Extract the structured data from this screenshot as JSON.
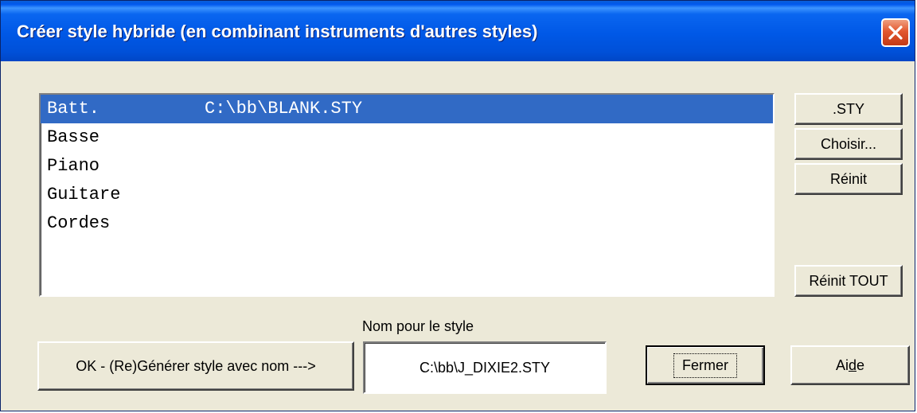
{
  "window": {
    "title": "Créer style hybride (en combinant instruments d'autres styles)"
  },
  "instrument_list": {
    "items": [
      {
        "name": "Batt.",
        "path": "C:\\bb\\BLANK.STY",
        "selected": true
      },
      {
        "name": "Basse",
        "path": "",
        "selected": false
      },
      {
        "name": "Piano",
        "path": "",
        "selected": false
      },
      {
        "name": "Guitare",
        "path": "",
        "selected": false
      },
      {
        "name": "Cordes",
        "path": "",
        "selected": false
      }
    ]
  },
  "side_buttons": {
    "sty_label": ".STY",
    "choose_label": "Choisir...",
    "reset_label": "Réinit",
    "reset_all_label": "Réinit TOUT"
  },
  "bottom": {
    "generate_label": "OK - (Re)Générer style avec nom --->",
    "style_name_label": "Nom pour le style",
    "style_name_value": "C:\\bb\\J_DIXIE2.STY",
    "close_label": "Fermer",
    "help_label_pre": "Ai",
    "help_label_ul": "d",
    "help_label_post": "e"
  },
  "colors": {
    "titlebar": "#0058e6",
    "selection": "#316ac5",
    "dialog_bg": "#ece9d8",
    "close_button": "#e2572e"
  }
}
